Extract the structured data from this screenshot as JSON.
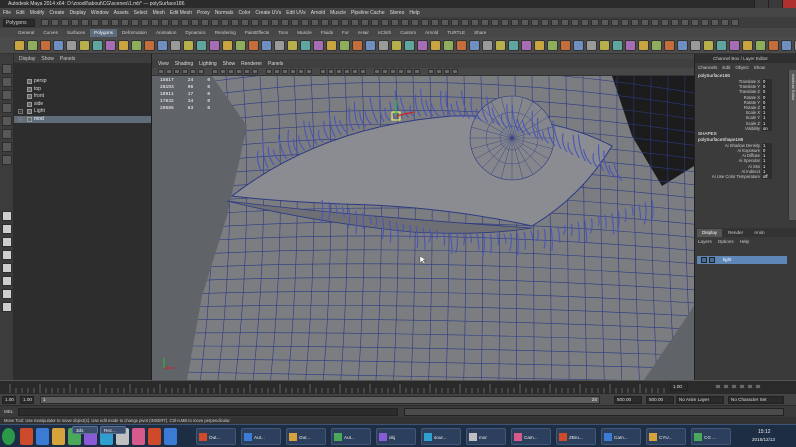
{
  "window": {
    "title": "Autodesk Maya 2014 x64: D:\\zooxill\\about\\CG\\scenes\\1.mb* --- polySurface186"
  },
  "menubar": {
    "items": [
      "File",
      "Edit",
      "Modify",
      "Create",
      "Display",
      "Window",
      "Assets",
      "Select",
      "Mesh",
      "Edit Mesh",
      "Proxy",
      "Normals",
      "Color",
      "Create UVs",
      "Edit UVs",
      "Arnold",
      "Muscle",
      "Pipeline Cache",
      "Stereo",
      "Help"
    ]
  },
  "statusline": {
    "mode": "Polygons"
  },
  "shelf": {
    "tabs": [
      "General",
      "Curves",
      "Surfaces",
      "Polygons",
      "Deformation",
      "Animation",
      "Dynamics",
      "Rendering",
      "PaintEffects",
      "Toon",
      "Muscle",
      "Fluids",
      "Fur",
      "nHair",
      "nCloth",
      "Custom",
      "Arnold",
      "TURTLE",
      "Share"
    ],
    "active_tab": "Polygons"
  },
  "outliner": {
    "menu": [
      "Display",
      "Show",
      "Panels"
    ],
    "items": [
      {
        "label": "persp",
        "selected": false
      },
      {
        "label": "top",
        "selected": false
      },
      {
        "label": "front",
        "selected": false
      },
      {
        "label": "side",
        "selected": false
      },
      {
        "label": "Light",
        "selected": false
      },
      {
        "label": "mod",
        "selected": true
      }
    ]
  },
  "viewport": {
    "menu": [
      "View",
      "Shading",
      "Lighting",
      "Show",
      "Renderer",
      "Panels"
    ],
    "hud": [
      {
        "label": "",
        "values": [
          "15617",
          "24",
          "0"
        ]
      },
      {
        "label": "",
        "values": [
          "28193",
          "96",
          "0"
        ]
      },
      {
        "label": "",
        "values": [
          "18911",
          "17",
          "0"
        ]
      },
      {
        "label": "",
        "values": [
          "17832",
          "34",
          "0"
        ]
      },
      {
        "label": "",
        "values": [
          "29585",
          "63",
          "0"
        ]
      }
    ]
  },
  "channel_box": {
    "header": "Channel Box / Layer Editor",
    "tabs": [
      "Channels",
      "Edit",
      "Object",
      "Show"
    ],
    "object_name": "polySurface186",
    "attributes": [
      {
        "name": "Translate X",
        "value": "0"
      },
      {
        "name": "Translate Y",
        "value": "0"
      },
      {
        "name": "Translate Z",
        "value": "0"
      },
      {
        "name": "Rotate X",
        "value": "0"
      },
      {
        "name": "Rotate Y",
        "value": "0"
      },
      {
        "name": "Rotate Z",
        "value": "0"
      },
      {
        "name": "Scale X",
        "value": "1"
      },
      {
        "name": "Scale Y",
        "value": "1"
      },
      {
        "name": "Scale Z",
        "value": "1"
      },
      {
        "name": "Visibility",
        "value": "on"
      }
    ],
    "shapes_label": "SHAPES",
    "shape_name": "polySurfaceShape186",
    "shape_attributes": [
      {
        "name": "Ai Shadow Density",
        "value": "1"
      },
      {
        "name": "Ai Exposure",
        "value": "0"
      },
      {
        "name": "Ai Diffuse",
        "value": "1"
      },
      {
        "name": "Ai Specular",
        "value": "1"
      },
      {
        "name": "Ai Sss",
        "value": "1"
      },
      {
        "name": "Ai Indirect",
        "value": "1"
      },
      {
        "name": "Ai Use Color Temperature",
        "value": "off"
      }
    ],
    "side_tab": "Attribute Editor"
  },
  "layer_editor": {
    "tabs": [
      "Display",
      "Render",
      "Anim"
    ],
    "active_tab": "Display",
    "menu": [
      "Layers",
      "Options",
      "Help"
    ],
    "layers": [
      {
        "name": "light",
        "visible": "V"
      }
    ]
  },
  "timeline": {
    "start_marker": "1.00",
    "end_marker": "1.00"
  },
  "range": {
    "start": "1.00",
    "inner_start": "1.00",
    "current": "1",
    "end": "24",
    "range_end": "500.00",
    "anim_end": "500.00",
    "anim_layer": "No Anim Layer",
    "char_set": "No Character Set"
  },
  "cmdline": {
    "label": "MEL"
  },
  "helpline": {
    "text": "Move Tool: Use manipulator to move object(s). Use edit mode to change pivot (INSERT). Ctrl+LMB to move perpendicular."
  },
  "taskbar": {
    "items": [
      "3ds",
      "Rec..."
    ],
    "apps": [
      "Out...",
      "Aut...",
      "Out...",
      "Aut...",
      "obj",
      "sour...",
      "mor",
      "Cam...",
      "ZBru...",
      "Cam...",
      "CYU...",
      "CG ..."
    ],
    "clock_time": "15:12",
    "clock_date": "2015/12/13"
  },
  "colors": {
    "viewport_bg": "#606468",
    "mesh": "#7b7d81",
    "wire": "#2c3a82",
    "lash": "#4a55b8",
    "selection": "#5f6c7a",
    "taskbar": "#1d2d44"
  }
}
